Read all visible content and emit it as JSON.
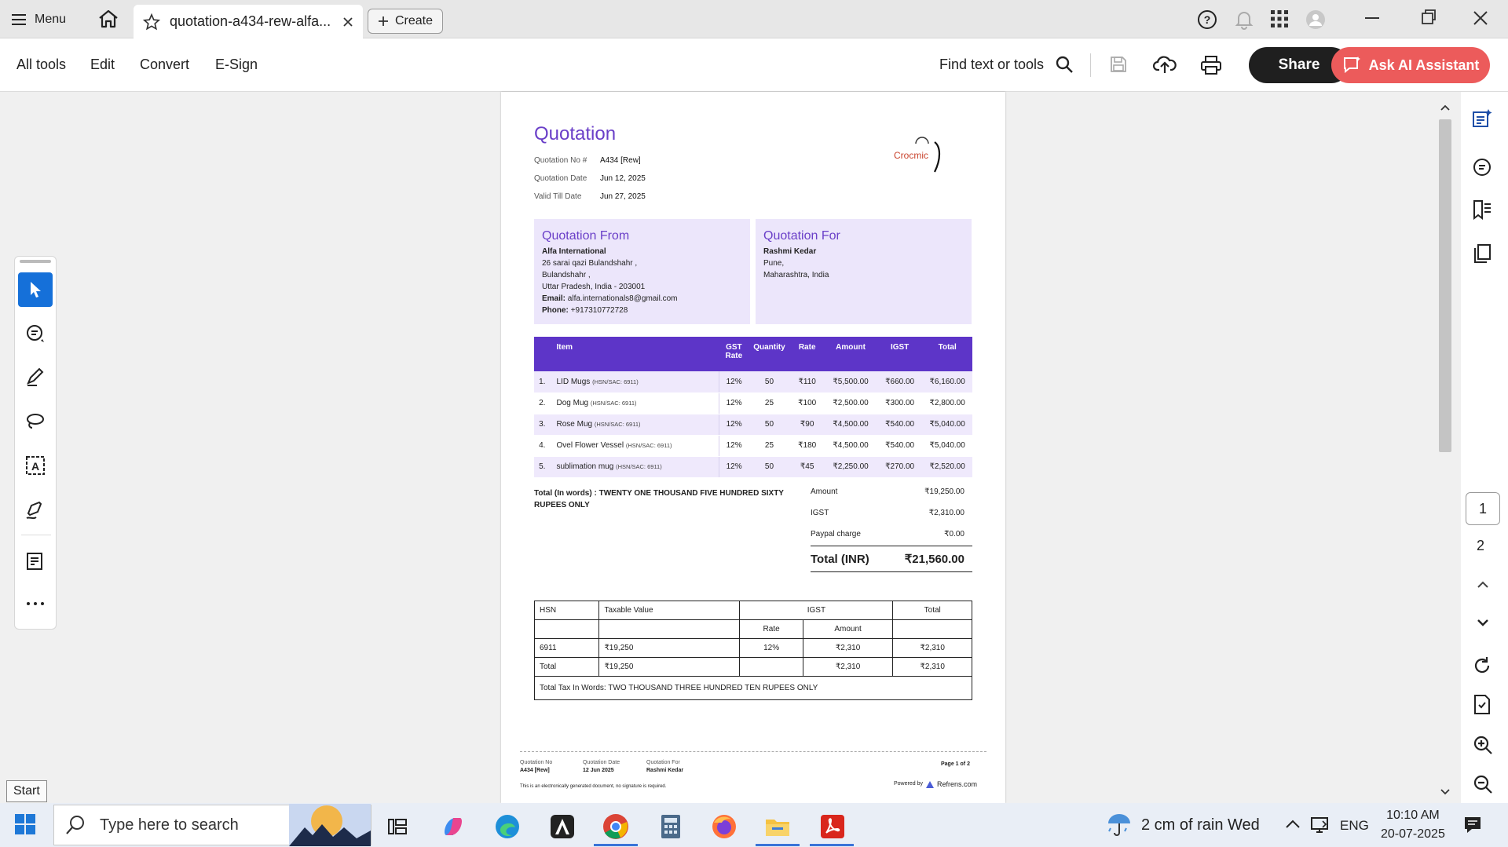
{
  "tabbar": {
    "menu_label": "Menu",
    "tab_title": "quotation-a434-rew-alfa...",
    "create_label": "Create"
  },
  "toolbar": {
    "menus": [
      "All tools",
      "Edit",
      "Convert",
      "E-Sign"
    ],
    "find_label": "Find text or tools",
    "share_label": "Share",
    "ai_label": "Ask AI Assistant"
  },
  "document": {
    "title": "Quotation",
    "meta": [
      {
        "key": "Quotation No #",
        "value": "A434 [Rew]"
      },
      {
        "key": "Quotation Date",
        "value": "Jun 12, 2025"
      },
      {
        "key": "Valid Till Date",
        "value": "Jun 27, 2025"
      }
    ],
    "logo_text": "Crocmic",
    "from": {
      "heading": "Quotation From",
      "name": "Alfa International",
      "lines": [
        "26 sarai qazi Bulandshahr ,",
        "Bulandshahr ,",
        "Uttar Pradesh, India - 203001"
      ],
      "email_label": "Email:",
      "email": "alfa.internationals8@gmail.com",
      "phone_label": "Phone:",
      "phone": "+917310772728"
    },
    "for": {
      "heading": "Quotation For",
      "name": "Rashmi Kedar",
      "lines": [
        "Pune,",
        "Maharashtra, India"
      ]
    },
    "items_header": {
      "item": "Item",
      "gst": "GST",
      "gst2": "Rate",
      "qty": "Quantity",
      "rate": "Rate",
      "amount": "Amount",
      "igst": "IGST",
      "total": "Total"
    },
    "items": [
      {
        "no": "1.",
        "name": "LID Mugs",
        "hsn": "(HSN/SAC: 6911)",
        "gst": "12%",
        "qty": "50",
        "rate": "₹110",
        "amount": "₹5,500.00",
        "igst": "₹660.00",
        "total": "₹6,160.00"
      },
      {
        "no": "2.",
        "name": "Dog Mug",
        "hsn": "(HSN/SAC: 6911)",
        "gst": "12%",
        "qty": "25",
        "rate": "₹100",
        "amount": "₹2,500.00",
        "igst": "₹300.00",
        "total": "₹2,800.00"
      },
      {
        "no": "3.",
        "name": "Rose Mug",
        "hsn": "(HSN/SAC: 6911)",
        "gst": "12%",
        "qty": "50",
        "rate": "₹90",
        "amount": "₹4,500.00",
        "igst": "₹540.00",
        "total": "₹5,040.00"
      },
      {
        "no": "4.",
        "name": "Ovel Flower Vessel",
        "hsn": "(HSN/SAC: 6911)",
        "gst": "12%",
        "qty": "25",
        "rate": "₹180",
        "amount": "₹4,500.00",
        "igst": "₹540.00",
        "total": "₹5,040.00"
      },
      {
        "no": "5.",
        "name": "sublimation mug",
        "hsn": "(HSN/SAC: 6911)",
        "gst": "12%",
        "qty": "50",
        "rate": "₹45",
        "amount": "₹2,250.00",
        "igst": "₹270.00",
        "total": "₹2,520.00"
      }
    ],
    "total_words": "Total (In words) : TWENTY ONE THOUSAND FIVE HUNDRED SIXTY RUPEES ONLY",
    "summary": [
      {
        "key": "Amount",
        "value": "₹19,250.00"
      },
      {
        "key": "IGST",
        "value": "₹2,310.00"
      },
      {
        "key": "Paypal charge",
        "value": "₹0.00"
      }
    ],
    "grand_total_label": "Total (INR)",
    "grand_total": "₹21,560.00",
    "tax_table": {
      "h_hsn": "HSN",
      "h_taxable": "Taxable Value",
      "h_igst": "IGST",
      "h_total": "Total",
      "h_rate": "Rate",
      "h_amount": "Amount",
      "row1": {
        "hsn": "6911",
        "taxable": "₹19,250",
        "rate": "12%",
        "amount": "₹2,310",
        "total": "₹2,310"
      },
      "row2": {
        "hsn": "Total",
        "taxable": "₹19,250",
        "rate": "",
        "amount": "₹2,310",
        "total": "₹2,310"
      },
      "words": "Total Tax In Words: TWO THOUSAND THREE HUNDRED TEN RUPEES ONLY"
    },
    "footer": {
      "q_no_label": "Quotation No",
      "q_no": "A434 [Rew]",
      "q_date_label": "Quotation Date",
      "q_date": "12 Jun 2025",
      "q_for_label": "Quotation For",
      "q_for": "Rashmi Kedar",
      "page": "Page 1 of 2",
      "note": "This is an electronically generated document, no signature is required.",
      "powered_label": "Powered by",
      "powered": "Refrens.com"
    }
  },
  "pages": {
    "current": "1",
    "next": "2"
  },
  "start_tip": "Start",
  "taskbar": {
    "search_placeholder": "Type here to search",
    "weather": "2 cm of rain Wed",
    "lang": "ENG",
    "time": "10:10 AM",
    "date": "20-07-2025"
  },
  "colors": {
    "accent": "#5d35c8",
    "accent_light": "#ece6fb",
    "ai_button": "#ec5b5b",
    "selected_tool": "#1570d9"
  }
}
